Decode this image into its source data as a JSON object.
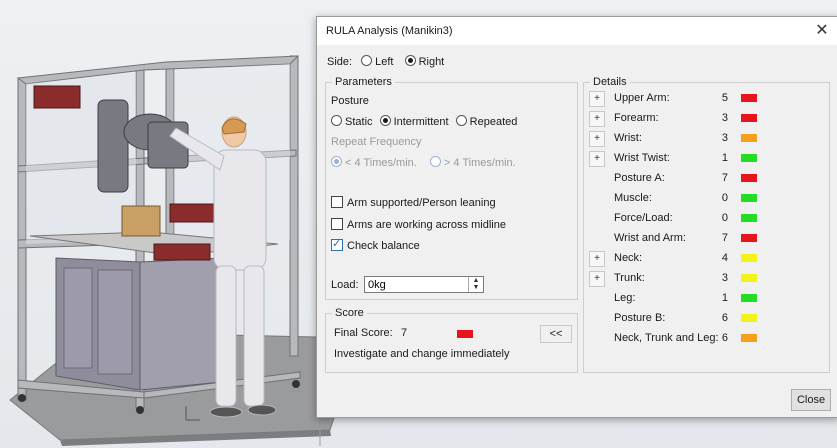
{
  "dialog": {
    "title": "RULA Analysis (Manikin3)",
    "close_glyph": "✕",
    "close_button": "Close"
  },
  "side": {
    "label": "Side:",
    "left": "Left",
    "right": "Right",
    "selected": "Right"
  },
  "parameters": {
    "legend": "Parameters",
    "posture_label": "Posture",
    "posture_options": [
      "Static",
      "Intermittent",
      "Repeated"
    ],
    "posture_selected": "Intermittent",
    "repeat_frequency_label": "Repeat Frequency",
    "freq_options": [
      "< 4 Times/min.",
      "> 4 Times/min."
    ],
    "freq_selected": "< 4 Times/min.",
    "arm_supported": {
      "label": "Arm supported/Person leaning",
      "checked": false
    },
    "arms_midline": {
      "label": "Arms are working across midline",
      "checked": false
    },
    "check_balance": {
      "label": "Check balance",
      "checked": true
    },
    "load_label": "Load:",
    "load_value": "0kg"
  },
  "score": {
    "legend": "Score",
    "final_label": "Final Score:",
    "final_value": "7",
    "final_color": "#e8141c",
    "collapse_button": "<<",
    "message": "Investigate and change immediately"
  },
  "details": {
    "legend": "Details",
    "plus_glyph": "+",
    "rows": [
      {
        "label": "Upper Arm:",
        "value": "5",
        "color": "#e8141c",
        "expandable": true
      },
      {
        "label": "Forearm:",
        "value": "3",
        "color": "#e8141c",
        "expandable": true
      },
      {
        "label": "Wrist:",
        "value": "3",
        "color": "#f5a01a",
        "expandable": true
      },
      {
        "label": "Wrist Twist:",
        "value": "1",
        "color": "#22dd22",
        "expandable": true
      },
      {
        "label": "Posture A:",
        "value": "7",
        "color": "#e8141c",
        "expandable": false
      },
      {
        "label": "Muscle:",
        "value": "0",
        "color": "#22dd22",
        "expandable": false
      },
      {
        "label": "Force/Load:",
        "value": "0",
        "color": "#22dd22",
        "expandable": false
      },
      {
        "label": "Wrist and Arm:",
        "value": "7",
        "color": "#e8141c",
        "expandable": false
      },
      {
        "label": "Neck:",
        "value": "4",
        "color": "#f2f218",
        "expandable": true
      },
      {
        "label": "Trunk:",
        "value": "3",
        "color": "#f2f218",
        "expandable": true
      },
      {
        "label": "Leg:",
        "value": "1",
        "color": "#22dd22",
        "expandable": false
      },
      {
        "label": "Posture B:",
        "value": "6",
        "color": "#f2f218",
        "expandable": false
      },
      {
        "label": "Neck, Trunk and Leg:",
        "value": "6",
        "color": "#f5a01a",
        "expandable": false
      }
    ]
  }
}
